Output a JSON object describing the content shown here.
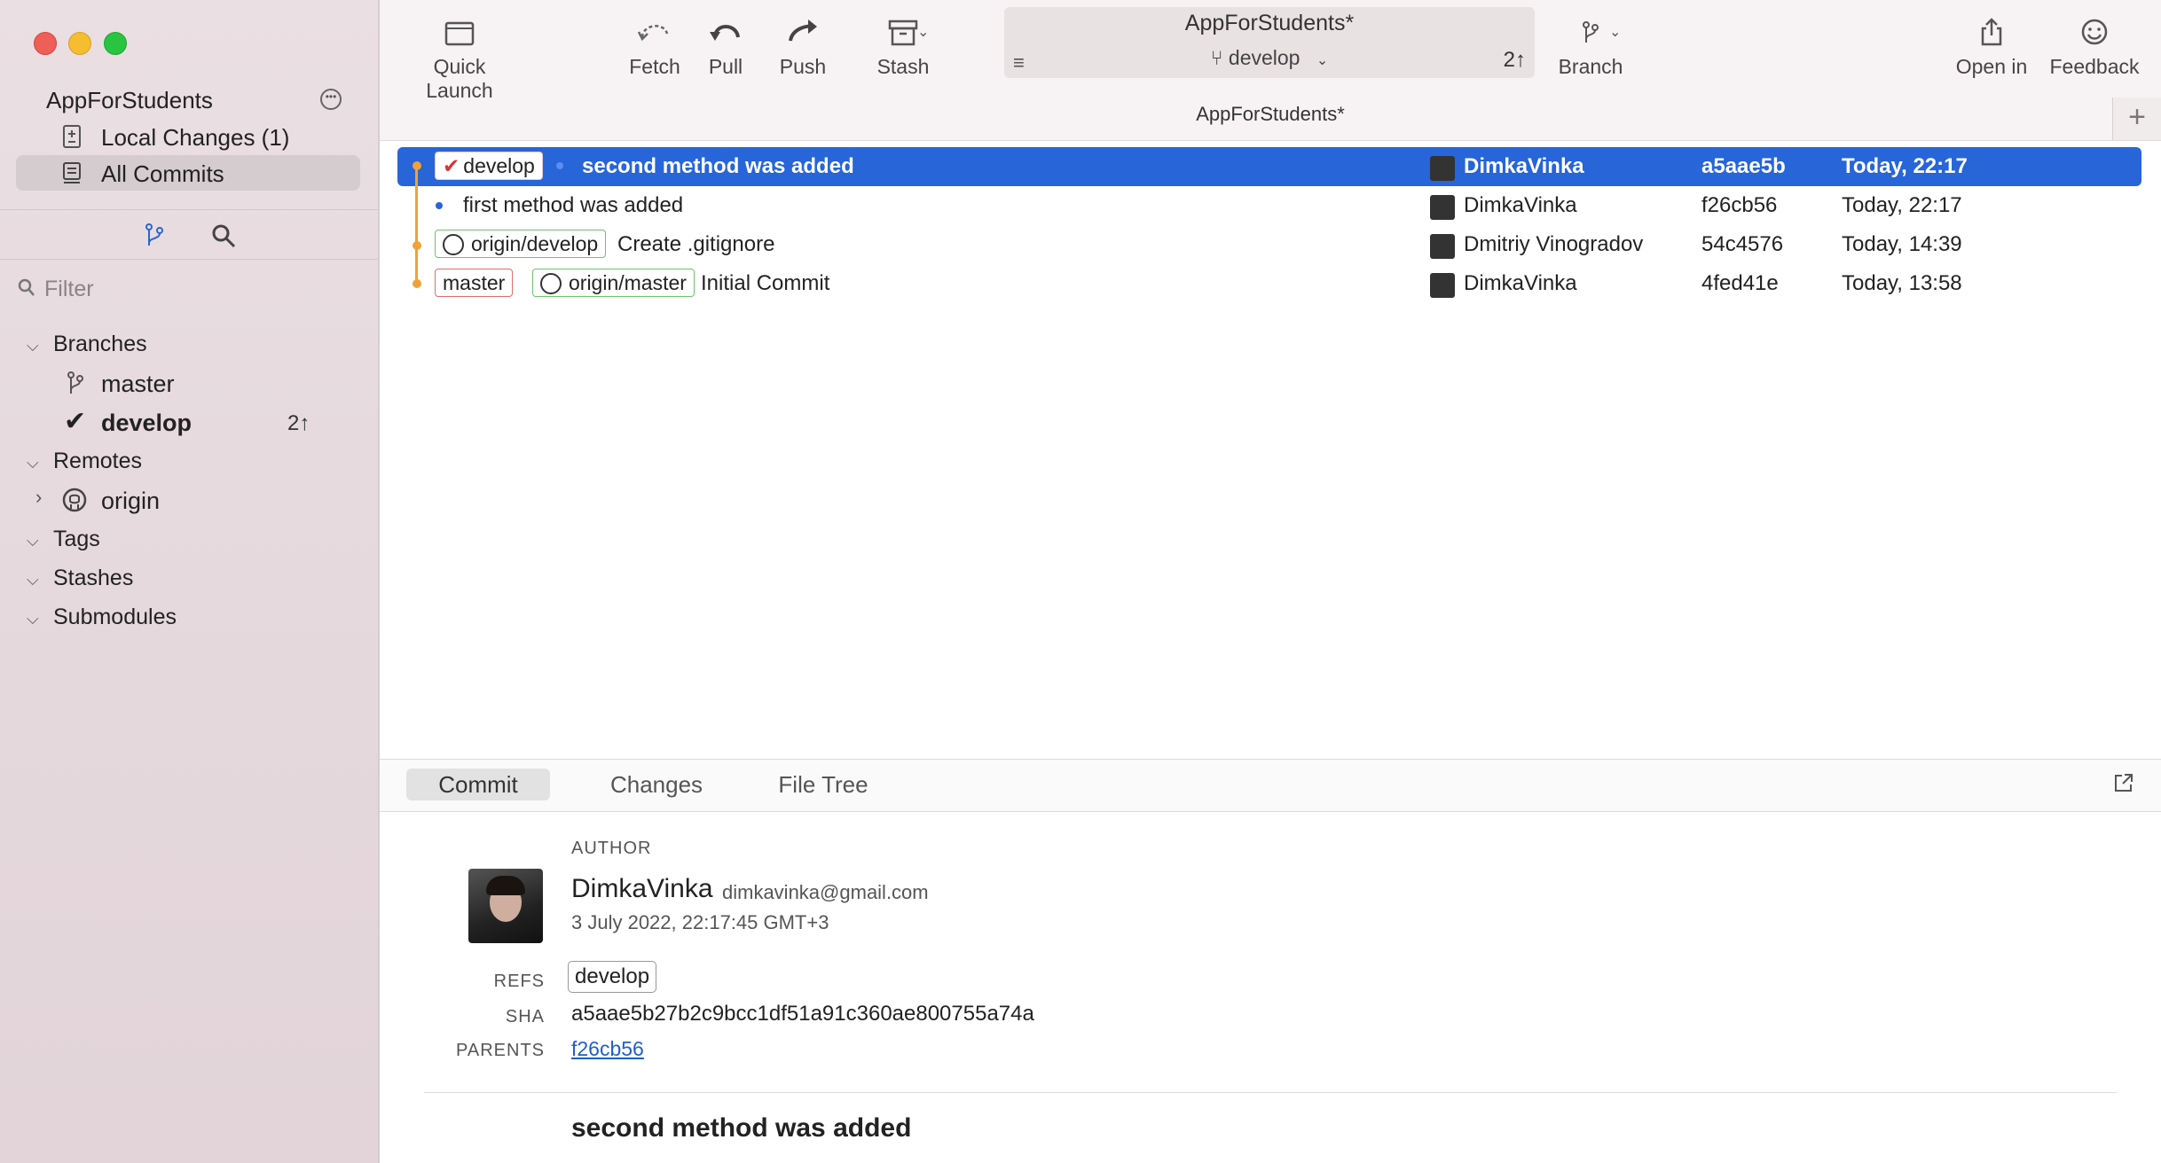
{
  "window": {
    "repo_name": "AppForStudents"
  },
  "sidebar": {
    "nav": [
      {
        "label": "Local Changes (1)"
      },
      {
        "label": "All Commits"
      }
    ],
    "filter_placeholder": "Filter",
    "sections": {
      "branches": "Branches",
      "remotes": "Remotes",
      "tags": "Tags",
      "stashes": "Stashes",
      "submodules": "Submodules"
    },
    "branches": [
      {
        "name": "master"
      },
      {
        "name": "develop",
        "ahead": "2↑"
      }
    ],
    "remotes": [
      {
        "name": "origin"
      }
    ]
  },
  "toolbar": {
    "quick_launch": "Quick Launch",
    "fetch": "Fetch",
    "pull": "Pull",
    "push": "Push",
    "stash": "Stash",
    "branch": "Branch",
    "open_in": "Open in",
    "feedback": "Feedback",
    "project_title": "AppForStudents*",
    "current_branch": "develop",
    "ahead": "2↑"
  },
  "tab": {
    "title": "AppForStudents*"
  },
  "commits": [
    {
      "refs": [
        "develop"
      ],
      "message": "second method was added",
      "author": "DimkaVinka",
      "sha": "a5aae5b",
      "date": "Today, 22:17"
    },
    {
      "refs": [],
      "message": "first method was added",
      "author": "DimkaVinka",
      "sha": "f26cb56",
      "date": "Today, 22:17"
    },
    {
      "refs": [
        "origin/develop"
      ],
      "message": "Create .gitignore",
      "author": "Dmitriy Vinogradov",
      "sha": "54c4576",
      "date": "Today, 14:39"
    },
    {
      "refs": [
        "master",
        "origin/master"
      ],
      "message": "Initial Commit",
      "author": "DimkaVinka",
      "sha": "4fed41e",
      "date": "Today, 13:58"
    }
  ],
  "detail": {
    "tabs": [
      "Commit",
      "Changes",
      "File Tree"
    ],
    "author_label": "AUTHOR",
    "author_name": "DimkaVinka",
    "author_email": "dimkavinka@gmail.com",
    "date": "3 July 2022, 22:17:45 GMT+3",
    "refs_label": "REFS",
    "ref": "develop",
    "sha_label": "SHA",
    "sha": "a5aae5b27b2c9bcc1df51a91c360ae800755a74a",
    "parents_label": "PARENTS",
    "parent": "f26cb56",
    "subject": "second method was added"
  },
  "colors": {
    "selection": "#2765d8",
    "graph": "#f0a23a",
    "local_ref_border": "#e06d6d",
    "remote_ref_border": "#6cc36c"
  }
}
